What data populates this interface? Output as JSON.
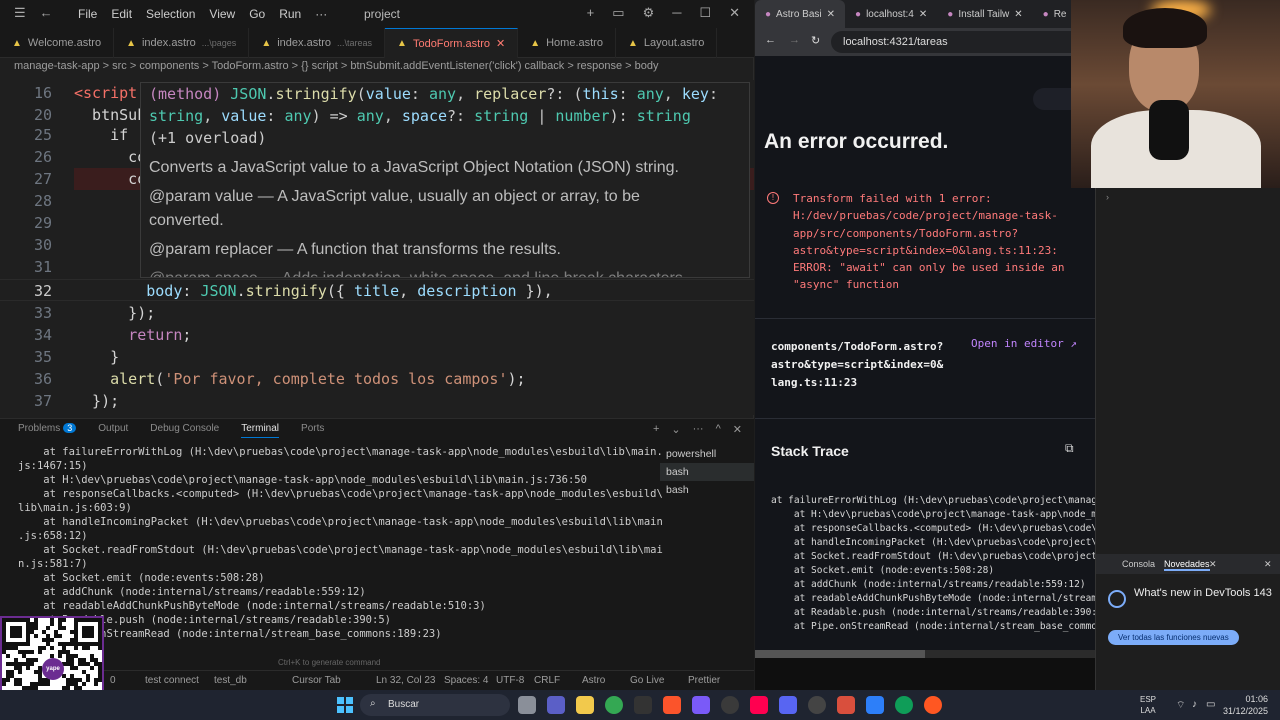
{
  "vscode": {
    "menu": [
      "File",
      "Edit",
      "Selection",
      "View",
      "Go",
      "Run",
      "···"
    ],
    "title": "project",
    "tabs": [
      {
        "label": "Welcome.astro",
        "sub": ""
      },
      {
        "label": "index.astro",
        "sub": "...\\pages"
      },
      {
        "label": "index.astro",
        "sub": "...\\tareas"
      },
      {
        "label": "TodoForm.astro",
        "sub": "",
        "active": true
      },
      {
        "label": "Home.astro",
        "sub": ""
      },
      {
        "label": "Layout.astro",
        "sub": ""
      }
    ],
    "breadcrumb": "manage-task-app  >  src  >  components  >  TodoForm.astro  >  {} script  >  btnSubmit.addEventListener('click') callback  >  response  >  body",
    "lines": [
      {
        "n": "16",
        "html": "<span class='tag'>&lt;script</span>"
      },
      {
        "n": "20",
        "html": "  btnSub"
      },
      {
        "n": "25",
        "html": "    if ("
      },
      {
        "n": "26",
        "html": "      co"
      },
      {
        "n": "27",
        "html": "      co"
      },
      {
        "n": "28",
        "html": ""
      },
      {
        "n": "29",
        "html": ""
      },
      {
        "n": "30",
        "html": ""
      },
      {
        "n": "31",
        "html": ""
      },
      {
        "n": "32",
        "html": "        <span class='var'>body</span>: <span class='cls'>JSON</span>.<span class='fn'>stringify</span>({ <span class='var'>title</span>, <span class='var'>description</span> }),"
      },
      {
        "n": "33",
        "html": "      });"
      },
      {
        "n": "34",
        "html": "      <span class='kw'>return</span>;"
      },
      {
        "n": "35",
        "html": "    }"
      },
      {
        "n": "36",
        "html": "    <span class='fn'>alert</span>(<span class='str'>'Por favor, complete todos los campos'</span>);"
      },
      {
        "n": "37",
        "html": "  });"
      }
    ],
    "hover": {
      "sig1": "(method) JSON.stringify(value: any, replacer?: (this: any, key:",
      "sig2": "string, value: any) => any, space?: string | number): string",
      "overload": "(+1 overload)",
      "desc": "Converts a JavaScript value to a JavaScript Object Notation (JSON) string.",
      "p1a": "@param value — A JavaScript value, usually an object or array, to be",
      "p1b": "converted.",
      "p2": "@param replacer — A function that transforms the results.",
      "p3": "@param space — Adds indentation, white space, and line break characters"
    },
    "panel_tabs": {
      "problems": "Problems",
      "problems_count": "3",
      "output": "Output",
      "debug": "Debug Console",
      "terminal": "Terminal",
      "ports": "Ports"
    },
    "terminal_lines": "    at failureErrorWithLog (H:\\dev\\pruebas\\code\\project\\manage-task-app\\node_modules\\esbuild\\lib\\main.\njs:1467:15)\n    at H:\\dev\\pruebas\\code\\project\\manage-task-app\\node_modules\\esbuild\\lib\\main.js:736:50\n    at responseCallbacks.<computed> (H:\\dev\\pruebas\\code\\project\\manage-task-app\\node_modules\\esbuild\\\nlib\\main.js:603:9)\n    at handleIncomingPacket (H:\\dev\\pruebas\\code\\project\\manage-task-app\\node_modules\\esbuild\\lib\\main\n.js:658:12)\n    at Socket.readFromStdout (H:\\dev\\pruebas\\code\\project\\manage-task-app\\node_modules\\esbuild\\lib\\mai\nn.js:581:7)\n    at Socket.emit (node:events:508:28)\n    at addChunk (node:internal/streams/readable:559:12)\n    at readableAddChunkPushByteMode (node:internal/streams/readable:510:3)\n    at Readable.push (node:internal/streams/readable:390:5)\n    at Pipe.onStreamRead (node:internal/stream_base_commons:189:23)",
    "shells": [
      "powershell",
      "bash",
      "bash"
    ],
    "ctrl_hint": "Ctrl+K to generate command",
    "status": {
      "errors": "0",
      "test": "test connect",
      "db": "test_db",
      "cursor": "Cursor Tab",
      "pos": "Ln 32, Col 23",
      "spaces": "Spaces: 4",
      "enc": "UTF-8",
      "eol": "CRLF",
      "lang": "Astro",
      "live": "Go Live",
      "prettier": "Prettier"
    }
  },
  "browser": {
    "tabs": [
      "Astro Basi",
      "localhost:4",
      "Install Tailw",
      "Re"
    ],
    "url": "localhost:4321/tareas",
    "error_title": "An error occurred.",
    "error_message": "Transform failed with 1 error:\nH:/dev/pruebas/code/project/manage-task-\napp/src/components/TodoForm.astro?\nastro&type=script&index=0&lang.ts:11:23:\nERROR: \"await\" can only be used inside an\n\"async\" function",
    "file": "components/TodoForm.astro?\nastro&type=script&index=0&\nlang.ts:11:23",
    "open_in_editor": "Open in editor",
    "stack_title": "Stack Trace",
    "stack": "at failureErrorWithLog (H:\\dev\\pruebas\\code\\project\\manage-\n    at H:\\dev\\pruebas\\code\\project\\manage-task-app\\node_mod\n    at responseCallbacks.<computed> (H:\\dev\\pruebas\\code\\pro\n    at handleIncomingPacket (H:\\dev\\pruebas\\code\\project\\ma\n    at Socket.readFromStdout (H:\\dev\\pruebas\\code\\project\\m\n    at Socket.emit (node:events:508:28)\n    at addChunk (node:internal/streams/readable:559:12)\n    at readableAddChunkPushByteMode (node:internal/streams/\n    at Readable.push (node:internal/streams/readable:390:5)\n    at Pipe.onStreamRead (node:internal/stream_base_commons",
    "devtools": {
      "console": "Consola",
      "news": "Novedades",
      "whatsnew": "What's new in DevTools 143",
      "button": "Ver todas las funciones nuevas"
    }
  },
  "taskbar": {
    "search": "Buscar",
    "lang1": "ESP",
    "lang2": "LAA",
    "time": "01:06",
    "date": "31/12/2025"
  },
  "qr": {
    "logo": "yape"
  }
}
